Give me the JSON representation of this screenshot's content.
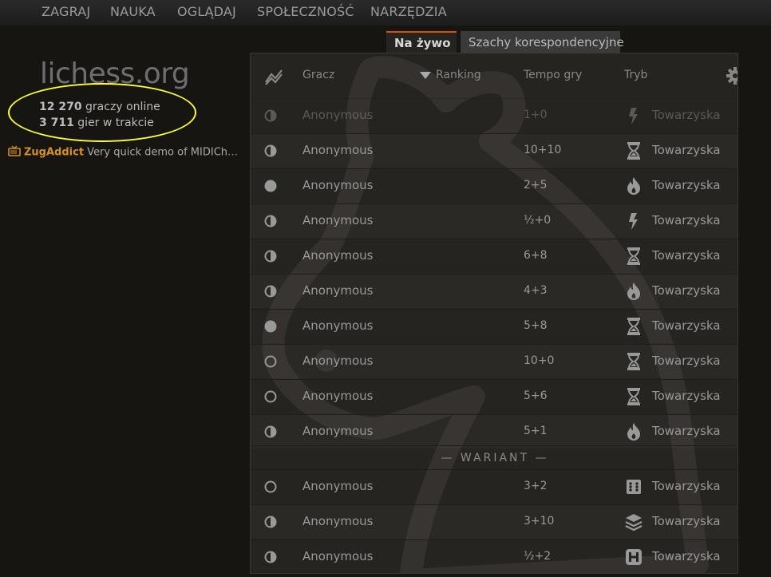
{
  "nav": {
    "items": [
      "ZAGRAJ",
      "NAUKA",
      "OGLĄDAJ",
      "SPOŁECZNOŚĆ",
      "NARZĘDZIA"
    ]
  },
  "side": {
    "logo": "lichess.org",
    "players_count": "12 270",
    "players_label": " graczy online",
    "games_count": "3 711",
    "games_label": " gier w trakcie",
    "stream_user": "ZugAddict",
    "stream_title": " Very quick demo of MIDIChes..."
  },
  "tabs": {
    "live": "Na żywo",
    "correspondence": "Szachy korespondencyjne"
  },
  "table": {
    "headers": {
      "player": "Gracz",
      "rating": "Ranking",
      "time": "Tempo gry",
      "mode": "Tryb"
    },
    "variant_label": "— WARIANT —",
    "rows": [
      {
        "side": "half",
        "player": "Anonymous",
        "time": "1+0",
        "perf": "bullet",
        "mode": "Towarzyska",
        "dim": true
      },
      {
        "side": "half",
        "player": "Anonymous",
        "time": "10+10",
        "perf": "rapid",
        "mode": "Towarzyska"
      },
      {
        "side": "black",
        "player": "Anonymous",
        "time": "2+5",
        "perf": "blitz",
        "mode": "Towarzyska"
      },
      {
        "side": "half",
        "player": "Anonymous",
        "time": "½+0",
        "perf": "bullet",
        "mode": "Towarzyska"
      },
      {
        "side": "half",
        "player": "Anonymous",
        "time": "6+8",
        "perf": "rapid",
        "mode": "Towarzyska"
      },
      {
        "side": "half",
        "player": "Anonymous",
        "time": "4+3",
        "perf": "blitz",
        "mode": "Towarzyska"
      },
      {
        "side": "black",
        "player": "Anonymous",
        "time": "5+8",
        "perf": "rapid",
        "mode": "Towarzyska"
      },
      {
        "side": "white",
        "player": "Anonymous",
        "time": "10+0",
        "perf": "rapid",
        "mode": "Towarzyska"
      },
      {
        "side": "white",
        "player": "Anonymous",
        "time": "5+6",
        "perf": "rapid",
        "mode": "Towarzyska"
      },
      {
        "side": "half",
        "player": "Anonymous",
        "time": "5+1",
        "perf": "blitz",
        "mode": "Towarzyska"
      }
    ],
    "variant_rows": [
      {
        "side": "white",
        "player": "Anonymous",
        "time": "3+2",
        "perf": "chess960",
        "mode": "Towarzyska"
      },
      {
        "side": "half",
        "player": "Anonymous",
        "time": "3+10",
        "perf": "crazyhouse",
        "mode": "Towarzyska"
      },
      {
        "side": "half",
        "player": "Anonymous",
        "time": "½+2",
        "perf": "horde",
        "mode": "Towarzyska"
      }
    ]
  }
}
